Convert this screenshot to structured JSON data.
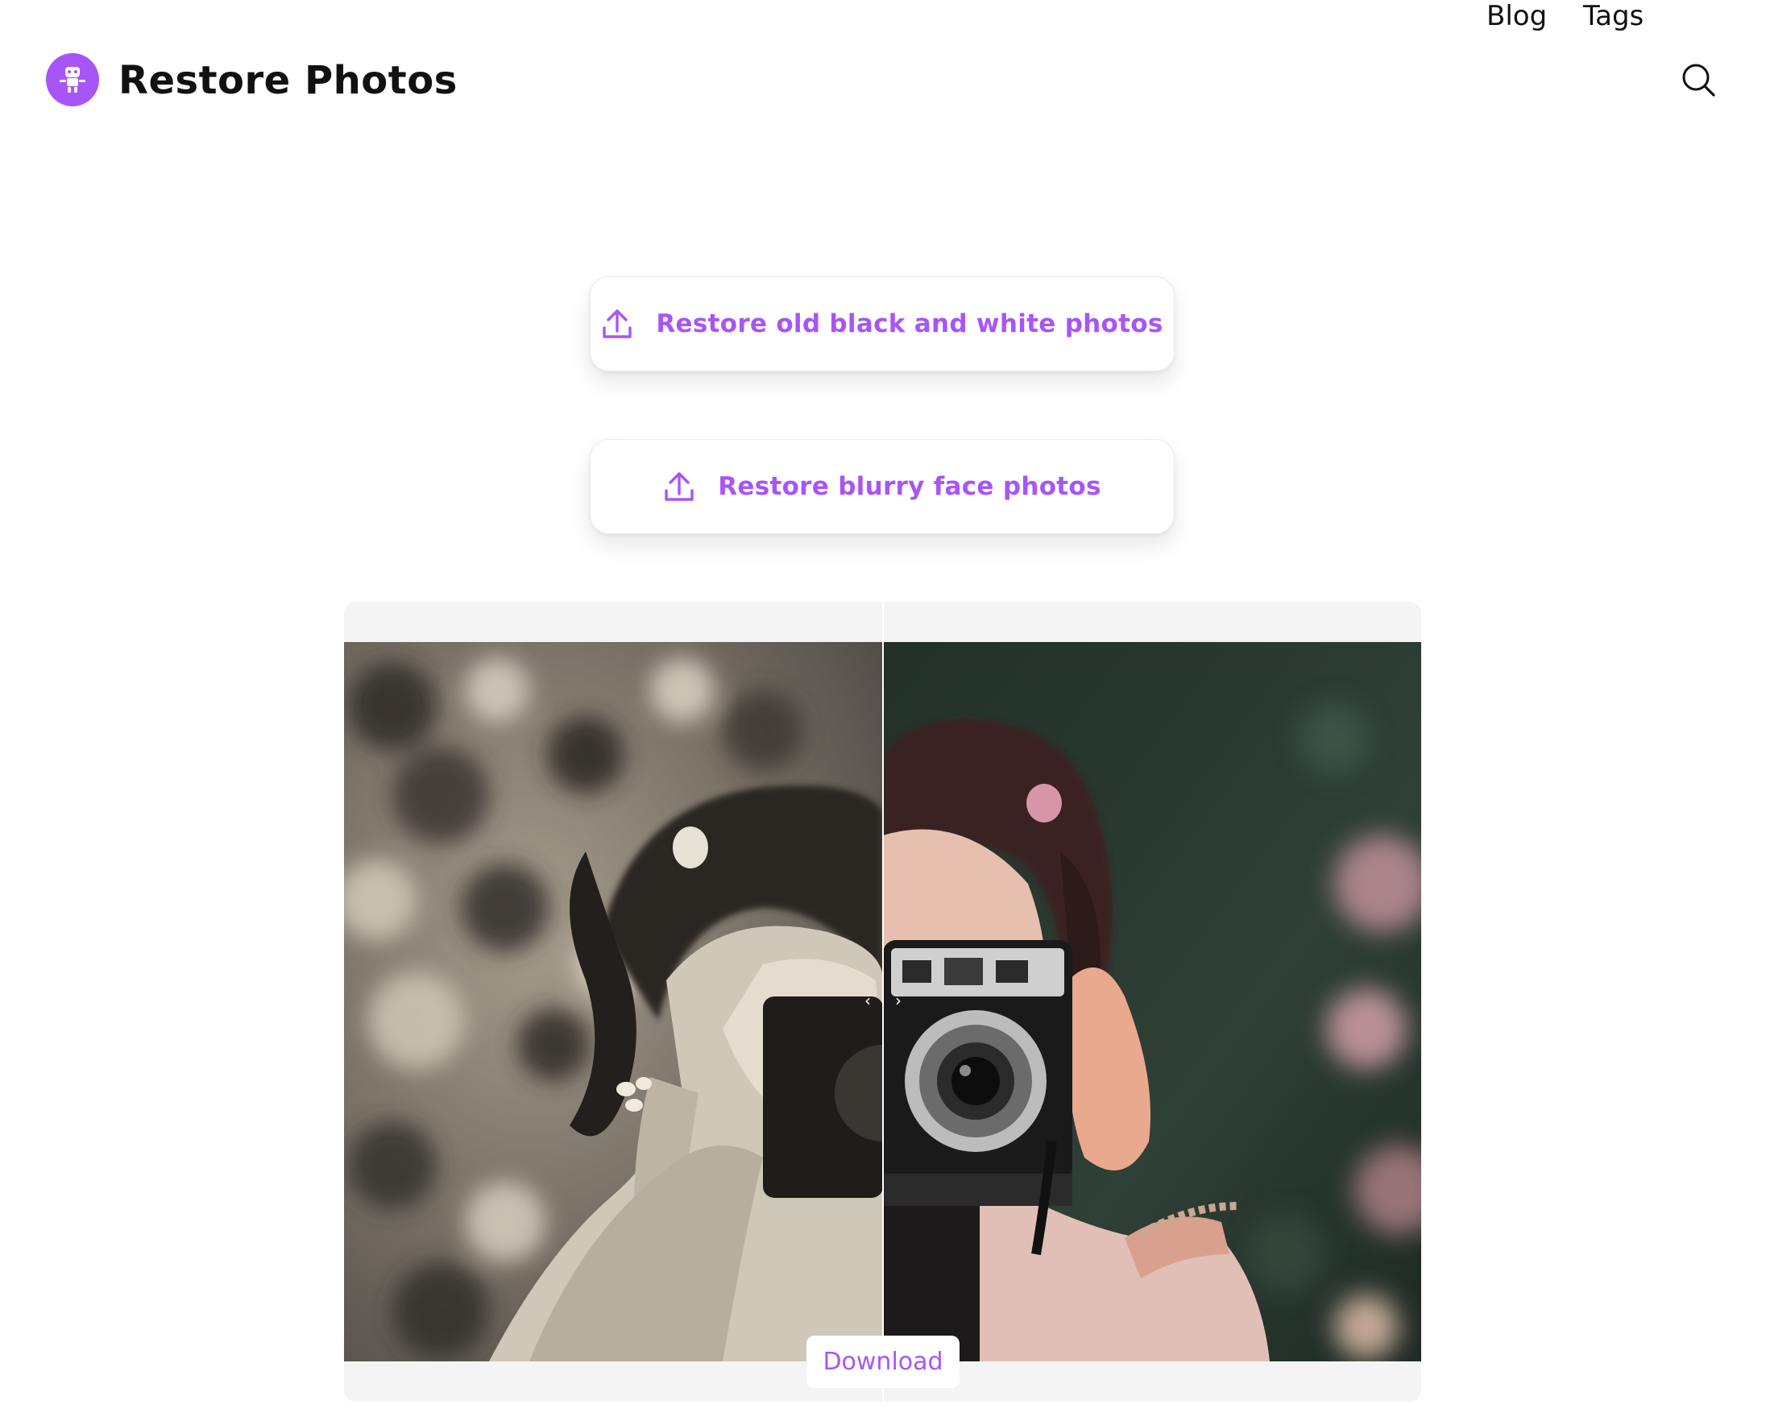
{
  "header": {
    "brand_name": "Restore Photos",
    "logo_icon": "robot-icon",
    "nav": [
      {
        "label": "Blog"
      },
      {
        "label": "Tags"
      }
    ],
    "search_icon": "search-icon"
  },
  "actions": {
    "restore_bw_label": "Restore old black and white photos",
    "restore_blurry_label": "Restore blurry face photos",
    "upload_icon": "upload-icon"
  },
  "comparison": {
    "download_label": "Download",
    "split_position": 0.5
  },
  "colors": {
    "accent": "#a855f7",
    "text": "#111111",
    "panel_bg": "#f4f4f5"
  }
}
